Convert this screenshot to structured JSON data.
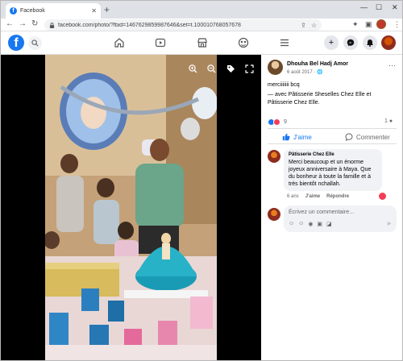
{
  "browser": {
    "tab_title": "Facebook",
    "url": "facebook.com/photo/?fbid=1467629859987646&set=t.100010768057678"
  },
  "colors": {
    "facebook_blue": "#1877f2",
    "comment_bg": "#f0f2f5",
    "love_red": "#f33e58"
  },
  "post": {
    "author": "Dhouha Bel Hadj Amor",
    "date": "6 août 2017 ·",
    "text": "merciiiiiii bcq",
    "tagline": "— avec Pâtisserie Sheselles Chez Elle et Pâtisserie Chez Elle.",
    "reaction_count": "9",
    "comment_count": "1",
    "like_label": "J'aime",
    "comment_label": "Commenter"
  },
  "comment": {
    "author": "Pâtisserie Chez Elle",
    "text": "Merci beaucoup et un énorme joyeux anniversaire à Maya. Que du bonheur à toute la famille et à très bientôt nchallah.",
    "age": "6 ans",
    "like": "J'aime",
    "reply": "Répondre"
  },
  "composer": {
    "placeholder": "Écrivez un commentaire…"
  }
}
